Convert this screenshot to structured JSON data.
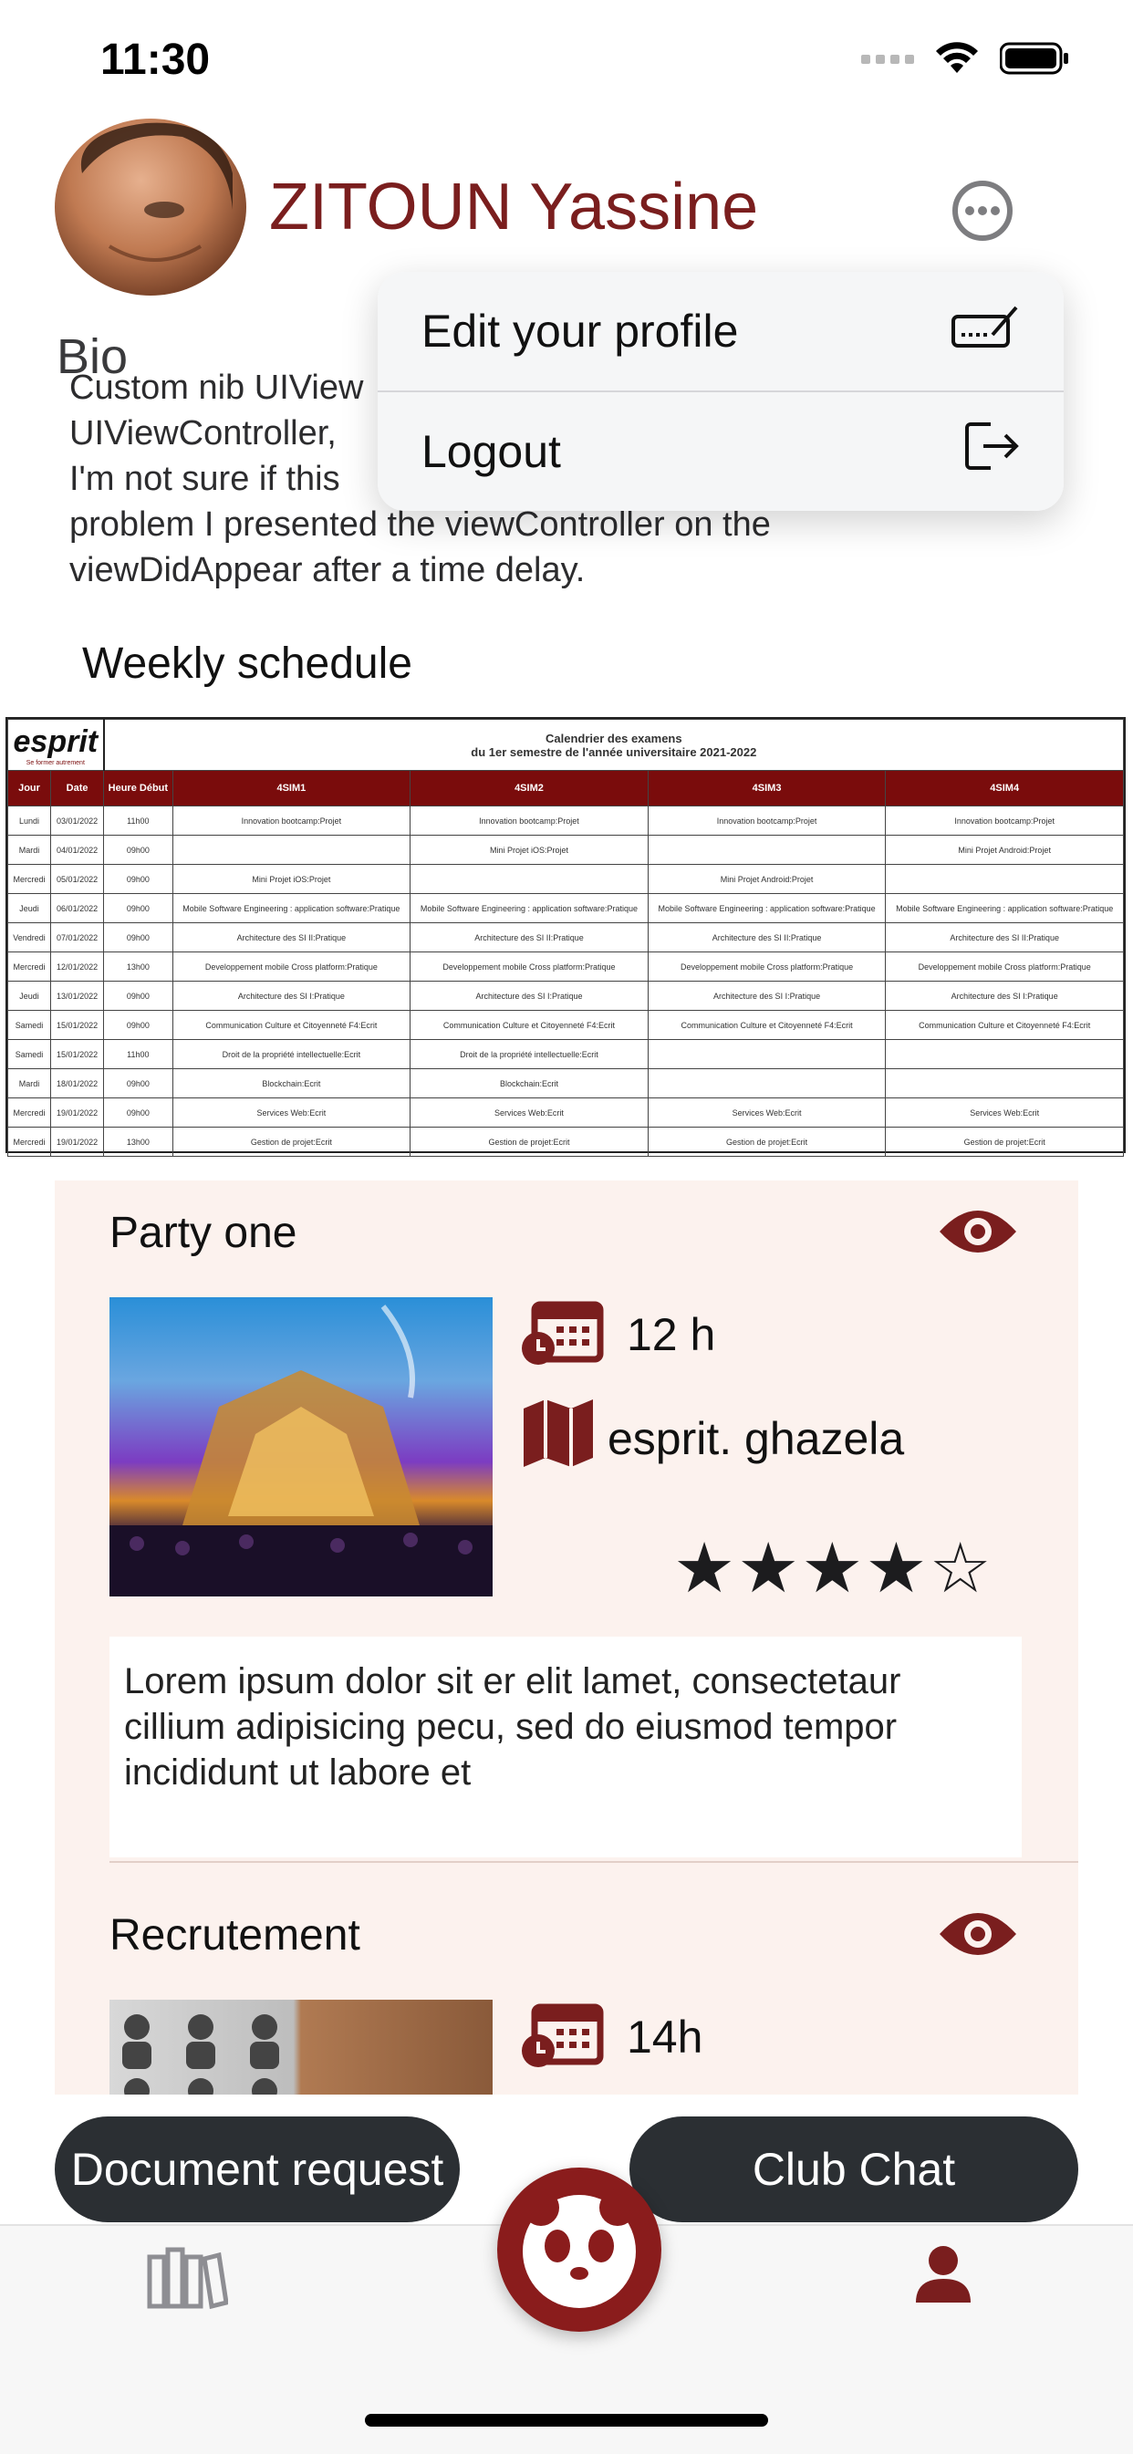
{
  "status_bar": {
    "time": "11:30"
  },
  "profile": {
    "name": "ZITOUN Yassine",
    "bio_label": "Bio",
    "bio_text": "Custom nib UIView\nUIViewController,\nI'm not sure if this\nproblem I presented the viewController on the\nviewDidAppear after a time delay."
  },
  "menu": {
    "items": [
      {
        "label": "Edit your profile",
        "icon": "edit-signature-icon"
      },
      {
        "label": "Logout",
        "icon": "logout-icon"
      }
    ]
  },
  "schedule": {
    "title": "Weekly schedule",
    "logo": "esprit",
    "logo_tagline": "Se former autrement",
    "heading_line1": "Calendrier des examens",
    "heading_line2": "du 1er semestre de l'année universitaire 2021-2022",
    "columns": [
      "Jour",
      "Date",
      "Heure Début",
      "4SIM1",
      "4SIM2",
      "4SIM3",
      "4SIM4"
    ],
    "rows": [
      [
        "Lundi",
        "03/01/2022",
        "11h00",
        "Innovation bootcamp:Projet",
        "Innovation bootcamp:Projet",
        "Innovation bootcamp:Projet",
        "Innovation bootcamp:Projet"
      ],
      [
        "Mardi",
        "04/01/2022",
        "09h00",
        "",
        "Mini Projet iOS:Projet",
        "",
        "Mini Projet Android:Projet"
      ],
      [
        "Mercredi",
        "05/01/2022",
        "09h00",
        "Mini Projet iOS:Projet",
        "",
        "Mini Projet Android:Projet",
        ""
      ],
      [
        "Jeudi",
        "06/01/2022",
        "09h00",
        "Mobile Software Engineering : application software:Pratique",
        "Mobile Software Engineering : application software:Pratique",
        "Mobile Software Engineering : application software:Pratique",
        "Mobile Software Engineering : application software:Pratique"
      ],
      [
        "Vendredi",
        "07/01/2022",
        "09h00",
        "Architecture des SI II:Pratique",
        "Architecture des SI II:Pratique",
        "Architecture des SI II:Pratique",
        "Architecture des SI II:Pratique"
      ],
      [
        "Mercredi",
        "12/01/2022",
        "13h00",
        "Developpement mobile Cross platform:Pratique",
        "Developpement mobile Cross platform:Pratique",
        "Developpement mobile Cross platform:Pratique",
        "Developpement mobile Cross platform:Pratique"
      ],
      [
        "Jeudi",
        "13/01/2022",
        "09h00",
        "Architecture des SI I:Pratique",
        "Architecture des SI I:Pratique",
        "Architecture des SI I:Pratique",
        "Architecture des SI I:Pratique"
      ],
      [
        "Samedi",
        "15/01/2022",
        "09h00",
        "Communication Culture et Citoyenneté F4:Ecrit",
        "Communication Culture et Citoyenneté F4:Ecrit",
        "Communication Culture et Citoyenneté F4:Ecrit",
        "Communication Culture et Citoyenneté F4:Ecrit"
      ],
      [
        "Samedi",
        "15/01/2022",
        "11h00",
        "Droit de la propriété intellectuelle:Ecrit",
        "Droit de la propriété intellectuelle:Ecrit",
        "",
        ""
      ],
      [
        "Mardi",
        "18/01/2022",
        "09h00",
        "Blockchain:Ecrit",
        "Blockchain:Ecrit",
        "",
        ""
      ],
      [
        "Mercredi",
        "19/01/2022",
        "09h00",
        "Services Web:Ecrit",
        "Services Web:Ecrit",
        "Services Web:Ecrit",
        "Services Web:Ecrit"
      ],
      [
        "Mercredi",
        "19/01/2022",
        "13h00",
        "Gestion de projet:Ecrit",
        "Gestion de projet:Ecrit",
        "Gestion de projet:Ecrit",
        "Gestion de projet:Ecrit"
      ]
    ]
  },
  "events": [
    {
      "title": "Party one",
      "duration": "12 h",
      "location": "esprit.  ghazela",
      "rating": 4,
      "rating_max": 5,
      "description": "Lorem ipsum dolor sit er elit lamet, consectetaur cillium adipisicing pecu, sed do eiusmod tempor incididunt ut labore et"
    },
    {
      "title": "Recrutement",
      "duration": "14h"
    }
  ],
  "buttons": {
    "document_request": "Document request",
    "club_chat": "Club Chat"
  },
  "colors": {
    "accent": "#7a1e1e",
    "dark_button": "#2b2f33",
    "card_bg": "#fcf2ee"
  }
}
